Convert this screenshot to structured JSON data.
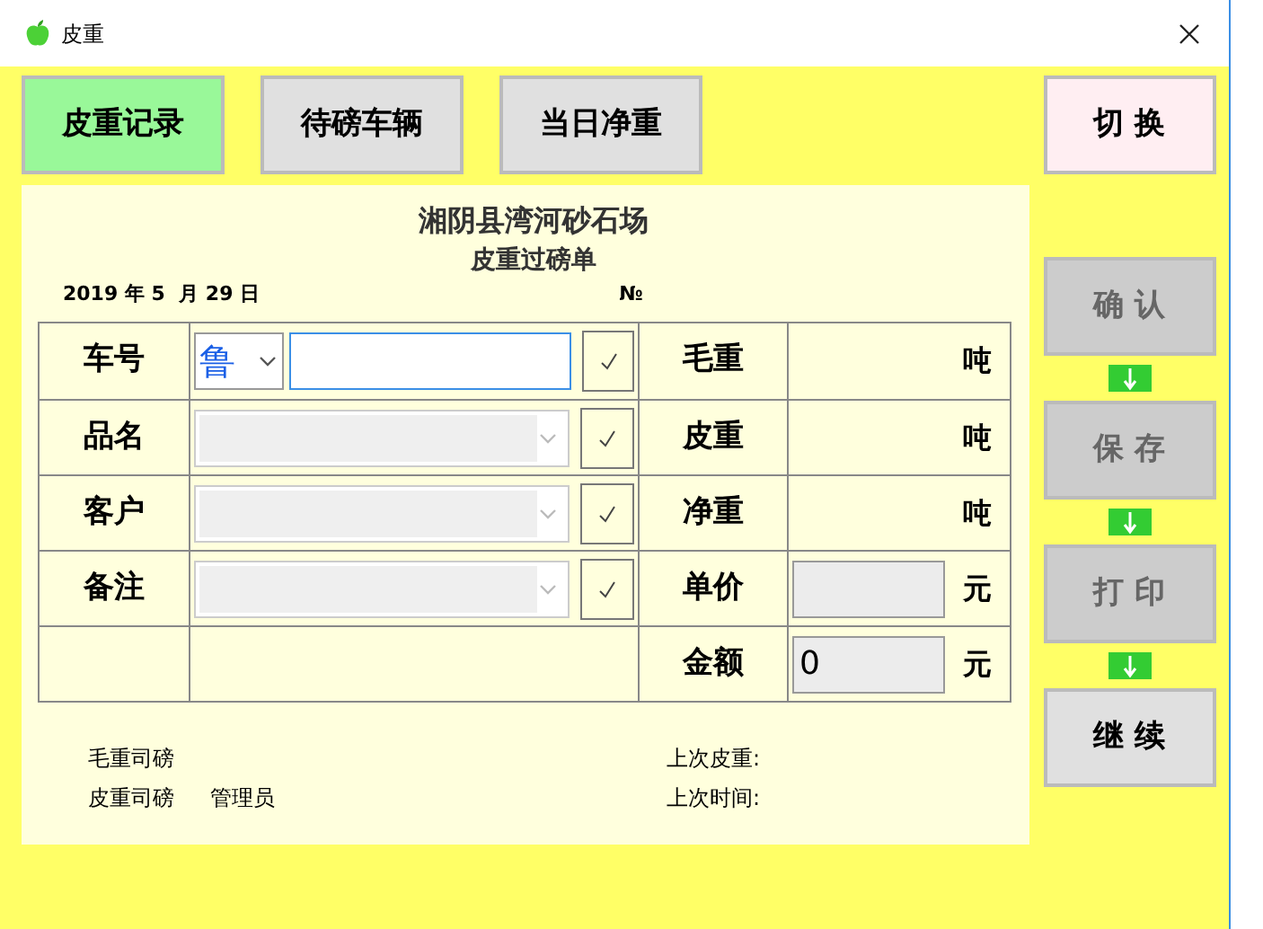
{
  "window": {
    "title": "皮重"
  },
  "tabs": [
    {
      "label": "皮重记录",
      "selected": true
    },
    {
      "label": "待磅车辆",
      "selected": false
    },
    {
      "label": "当日净重",
      "selected": false
    }
  ],
  "switch_button": "切 换",
  "form": {
    "company": "湘阴县湾河砂石场",
    "title": "皮重过磅单",
    "date": "2019 年 5  月 29 日",
    "number_label": "№",
    "rows": [
      {
        "label": "车号",
        "input": {
          "kind": "plate",
          "prefix": "鲁"
        },
        "measure": {
          "label": "毛重",
          "kind": "plain",
          "unit": "吨"
        }
      },
      {
        "label": "品名",
        "input": {
          "kind": "combo"
        },
        "measure": {
          "label": "皮重",
          "kind": "plain",
          "unit": "吨"
        }
      },
      {
        "label": "客户",
        "input": {
          "kind": "combo"
        },
        "measure": {
          "label": "净重",
          "kind": "plain",
          "unit": "吨"
        }
      },
      {
        "label": "备注",
        "input": {
          "kind": "combo"
        },
        "measure": {
          "label": "单价",
          "kind": "field",
          "unit": "元"
        }
      },
      {
        "input": {
          "kind": "none"
        },
        "measure": {
          "label": "金额",
          "kind": "field",
          "value": "0",
          "unit": "元"
        }
      }
    ],
    "footer_left": [
      {
        "label": "毛重司磅"
      },
      {
        "label": "皮重司磅",
        "value": "管理员"
      }
    ],
    "footer_right": [
      "上次皮重:",
      "上次时间:"
    ]
  },
  "actions": [
    {
      "label": "确 认",
      "disabled": true
    },
    {
      "label": "保 存",
      "disabled": true
    },
    {
      "label": "打 印",
      "disabled": true
    },
    {
      "label": "继 续",
      "disabled": false
    }
  ]
}
